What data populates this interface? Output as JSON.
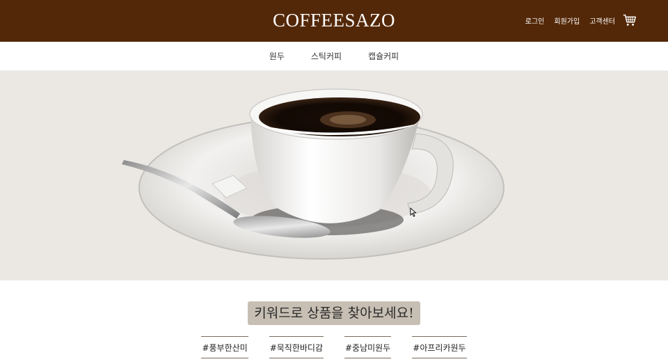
{
  "header": {
    "logo": "COFFEESAZO",
    "login_label": "로그인",
    "signup_label": "회원가입",
    "support_label": "고객센터",
    "cart_icon": "cart-icon",
    "background": "#532808"
  },
  "nav": {
    "items": [
      {
        "label": "원두"
      },
      {
        "label": "스틱커피"
      },
      {
        "label": "캡슐커피"
      }
    ]
  },
  "hero": {
    "image": "coffee-cup-with-spoon-on-saucer",
    "background": "#ebe8e4"
  },
  "keywords": {
    "title": "키워드로 상품을 찾아보세요!",
    "title_background": "#c7bfb3",
    "tags": [
      {
        "label": "#풍부한산미"
      },
      {
        "label": "#묵직한바디감"
      },
      {
        "label": "#중남미원두"
      },
      {
        "label": "#아프리카원두"
      }
    ]
  }
}
